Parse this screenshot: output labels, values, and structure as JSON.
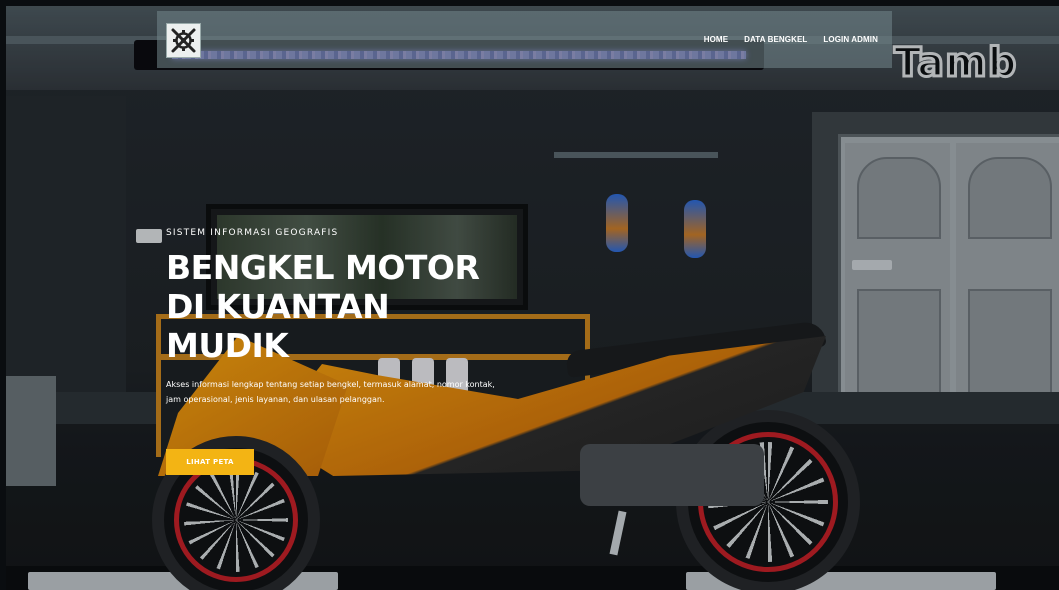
{
  "navbar": {
    "logo_icon": "gear-wrench-logo-icon",
    "links": [
      {
        "label": "HOME"
      },
      {
        "label": "DATA BENGKEL"
      },
      {
        "label": "LOGIN ADMIN"
      }
    ]
  },
  "hero": {
    "eyebrow": "SISTEM INFORMASI GEOGRAFIS",
    "headline_lines": [
      "BENGKEL MOTOR",
      "DI KUANTAN",
      "MUDIK"
    ],
    "description": "Akses informasi lengkap tentang setiap bengkel, termasuk alamat, nomor kontak, jam operasional, jenis layanan, dan ulasan pelanggan.",
    "cta_label": "LIHAT PETA",
    "background_sign_text": "Tamb"
  },
  "colors": {
    "accent": "#f3b414",
    "navbar_bg": "rgba(115,135,140,0.55)",
    "text": "#ffffff"
  }
}
